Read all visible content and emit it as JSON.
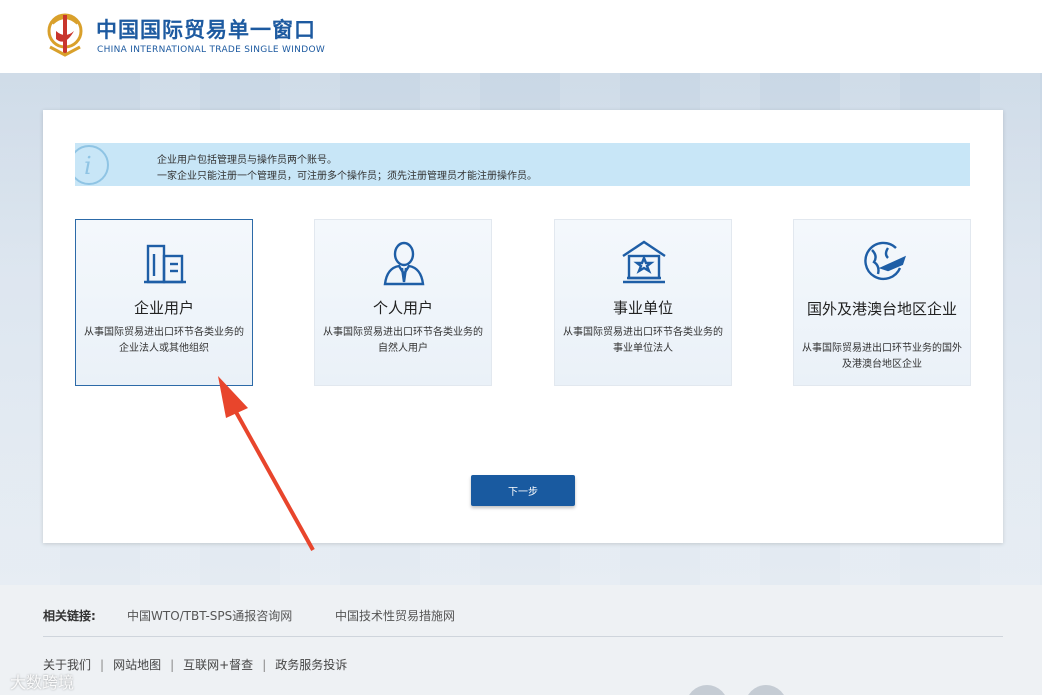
{
  "header": {
    "brand_cn": "中国国际贸易单一窗口",
    "brand_en": "CHINA INTERNATIONAL TRADE SINGLE WINDOW"
  },
  "notice": {
    "line1": "企业用户包括管理员与操作员两个账号。",
    "line2": "一家企业只能注册一个管理员，可注册多个操作员；须先注册管理员才能注册操作员。"
  },
  "cards": [
    {
      "title": "企业用户",
      "desc": "从事国际贸易进出口环节各类业务的企业法人或其他组织",
      "icon": "building-icon",
      "selected": true
    },
    {
      "title": "个人用户",
      "desc": "从事国际贸易进出口环节各类业务的自然人用户",
      "icon": "person-icon",
      "selected": false
    },
    {
      "title": "事业单位",
      "desc": "从事国际贸易进出口环节各类业务的事业单位法人",
      "icon": "institution-icon",
      "selected": false
    },
    {
      "title": "国外及港澳台地区企业",
      "desc": "从事国际贸易进出口环节业务的国外及港澳台地区企业",
      "icon": "globe-plane-icon",
      "selected": false
    }
  ],
  "next_button": "下一步",
  "footer": {
    "links_label": "相关链接:",
    "links": [
      "中国WTO/TBT-SPS通报咨询网",
      "中国技术性贸易措施网"
    ],
    "nav": [
      "关于我们",
      "网站地图",
      "互联网+督查",
      "政务服务投诉"
    ],
    "watermark": "大数跨境"
  },
  "colors": {
    "brand": "#1d5aa0",
    "button": "#195aa0",
    "notice_bg": "#c8e6f7",
    "arrow": "#e8452c"
  }
}
